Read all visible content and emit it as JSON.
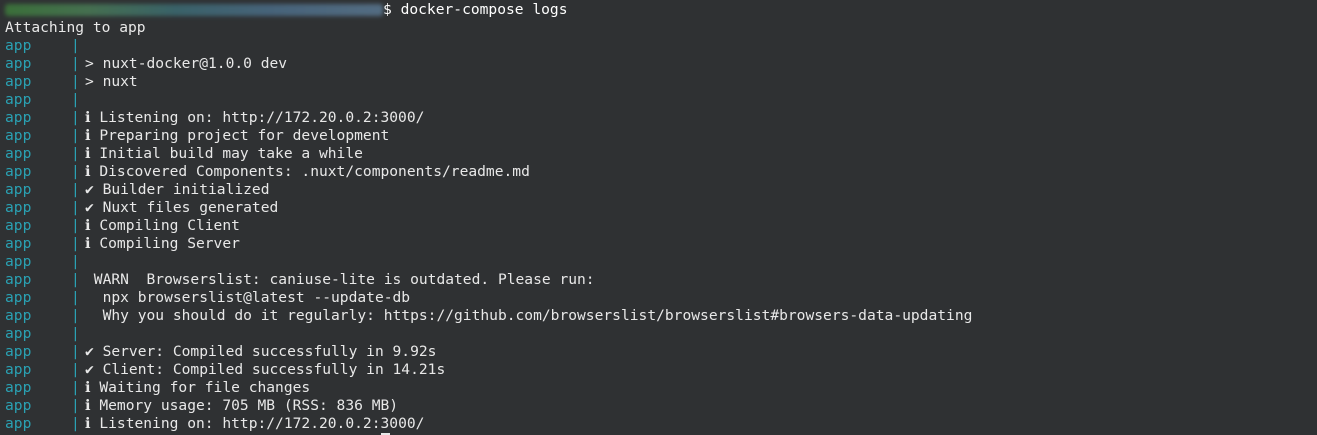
{
  "prompt": {
    "command": "$ docker-compose logs"
  },
  "attach_text": "Attaching to app",
  "log_lines": [
    {
      "service": "app",
      "sep": "|",
      "text": ""
    },
    {
      "service": "app",
      "sep": "|",
      "text": "> nuxt-docker@1.0.0 dev"
    },
    {
      "service": "app",
      "sep": "|",
      "text": "> nuxt"
    },
    {
      "service": "app",
      "sep": "|",
      "text": ""
    },
    {
      "service": "app",
      "sep": "|",
      "text": "ℹ Listening on: http://172.20.0.2:3000/"
    },
    {
      "service": "app",
      "sep": "|",
      "text": "ℹ Preparing project for development"
    },
    {
      "service": "app",
      "sep": "|",
      "text": "ℹ Initial build may take a while"
    },
    {
      "service": "app",
      "sep": "|",
      "text": "ℹ Discovered Components: .nuxt/components/readme.md"
    },
    {
      "service": "app",
      "sep": "|",
      "text": "✔ Builder initialized"
    },
    {
      "service": "app",
      "sep": "|",
      "text": "✔ Nuxt files generated"
    },
    {
      "service": "app",
      "sep": "|",
      "text": "ℹ Compiling Client"
    },
    {
      "service": "app",
      "sep": "|",
      "text": "ℹ Compiling Server"
    },
    {
      "service": "app",
      "sep": "|",
      "text": ""
    },
    {
      "service": "app",
      "sep": "|",
      "text": " WARN  Browserslist: caniuse-lite is outdated. Please run:"
    },
    {
      "service": "app",
      "sep": "|",
      "text": "  npx browserslist@latest --update-db"
    },
    {
      "service": "app",
      "sep": "|",
      "text": "  Why you should do it regularly: https://github.com/browserslist/browserslist#browsers-data-updating"
    },
    {
      "service": "app",
      "sep": "|",
      "text": ""
    },
    {
      "service": "app",
      "sep": "|",
      "text": "✔ Server: Compiled successfully in 9.92s"
    },
    {
      "service": "app",
      "sep": "|",
      "text": "✔ Client: Compiled successfully in 14.21s"
    },
    {
      "service": "app",
      "sep": "|",
      "text": "ℹ Waiting for file changes"
    },
    {
      "service": "app",
      "sep": "|",
      "text": "ℹ Memory usage: 705 MB (RSS: 836 MB)"
    },
    {
      "service": "app",
      "sep": "|",
      "text": "ℹ Listening on: http://172.20.0.2:3000/"
    }
  ],
  "colors": {
    "background": "#2f3133",
    "service_prefix": "#2aa1b3",
    "text": "#e8e8e8"
  }
}
